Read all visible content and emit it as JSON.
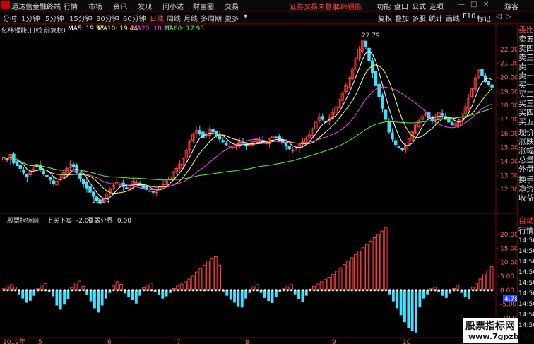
{
  "menubar": {
    "app_title": "通达信金融终端",
    "items": [
      "行情",
      "市场",
      "资讯",
      "发现",
      "问小达",
      "财富圈",
      "交易"
    ],
    "notice": "证券交易未登录",
    "notice2": "亿纬锂能",
    "right_items": [
      "功能",
      "盘口",
      "公式",
      "选项"
    ],
    "guest": "游客"
  },
  "toolbar": {
    "periods": [
      "分时",
      "1分钟",
      "5分钟",
      "15分钟",
      "30分钟",
      "60分钟",
      "日线",
      "周线",
      "月线",
      "多周期",
      "更多"
    ],
    "active_period": "日线",
    "right_items": [
      "复权",
      "叠加",
      "多股",
      "统计",
      "画线",
      "F10",
      "标记"
    ]
  },
  "main_chart": {
    "title": "亿纬锂能(日线 前复权)",
    "ma": [
      {
        "label": "MA5: 19.57",
        "color": "#ffffff"
      },
      {
        "label": "MA10: 19.44",
        "color": "#ffff40"
      },
      {
        "label": "MA20: 18.27",
        "color": "#ff40ff"
      },
      {
        "label": "MA60: 17.93",
        "color": "#40ff40"
      }
    ],
    "price_ticks": [
      "22.00",
      "21.00",
      "20.00",
      "19.00",
      "18.00",
      "17.00",
      "16.00",
      "15.00",
      "14.00",
      "13.00",
      "12.00"
    ],
    "high_label": "22.79",
    "low_label": "10.94"
  },
  "sub_chart": {
    "title": "股票指标网",
    "signal_label": "上买下卖: -2.00",
    "divider_label": "强弱分界: 0.00",
    "ticks": [
      "20.00",
      "15.00",
      "10.00",
      "5.00",
      "0.00",
      "-5.00",
      "-10.00"
    ],
    "current_value": "4.78"
  },
  "x_axis": {
    "labels": [
      "2019年",
      "5",
      "6",
      "7",
      "8",
      "9",
      "10"
    ]
  },
  "right_panel": {
    "quote_items": [
      "委比",
      "卖五",
      "卖四",
      "卖三",
      "卖二",
      "卖一",
      "买一",
      "买二",
      "买三",
      "买四",
      "买五",
      "现价",
      "涨跌",
      "涨幅",
      "总量",
      "外盘",
      "换手",
      "净资",
      "收益"
    ],
    "tabs": [
      "自动",
      "行情"
    ],
    "times": [
      "14:50",
      "14:50",
      "14:50",
      "14:50",
      "14:50",
      "14:50",
      "14:50",
      "14:50",
      "14:50",
      "14:50",
      "14:50"
    ]
  },
  "watermark": {
    "line1": "股票指标网",
    "line2": "www.7gpzb.com"
  },
  "colors": {
    "up": "#ff4040",
    "down": "#40e0ff",
    "ma5": "#ffffff",
    "ma10": "#ffff40",
    "ma20": "#ff40ff",
    "ma60": "#40ff40",
    "grid": "#7a0000"
  },
  "chart_data": {
    "type": "candlestick",
    "price_range": [
      10.6,
      23.3
    ],
    "candles_close": [
      14.3,
      14.1,
      14.5,
      13.9,
      13.7,
      13.5,
      13.2,
      12.9,
      13.3,
      13.6,
      13.8,
      13.4,
      13.1,
      12.9,
      12.7,
      12.4,
      12.6,
      12.9,
      13.2,
      13.5,
      13.8,
      13.6,
      13.2,
      12.8,
      12.4,
      12.1,
      11.8,
      11.5,
      11.2,
      11.0,
      11.3,
      11.7,
      12.0,
      12.3,
      12.5,
      12.4,
      12.2,
      12.1,
      12.3,
      12.6,
      12.5,
      12.3,
      12.1,
      12.0,
      11.9,
      11.8,
      12.0,
      12.2,
      12.4,
      12.6,
      12.9,
      13.2,
      13.5,
      13.8,
      14.2,
      14.8,
      15.4,
      15.9,
      16.2,
      16.0,
      15.7,
      15.9,
      16.3,
      16.1,
      15.8,
      15.6,
      15.4,
      15.2,
      15.1,
      15.0,
      15.2,
      15.4,
      15.3,
      15.1,
      15.2,
      15.4,
      15.6,
      15.5,
      15.3,
      15.4,
      15.6,
      15.8,
      15.7,
      15.5,
      15.3,
      15.1,
      14.9,
      14.8,
      15.0,
      15.2,
      15.4,
      15.6,
      15.9,
      16.3,
      16.8,
      17.2,
      17.0,
      16.8,
      17.1,
      17.5,
      17.9,
      18.4,
      18.9,
      19.4,
      19.9,
      20.6,
      21.3,
      22.0,
      22.6,
      22.2,
      21.2,
      20.3,
      19.4,
      18.6,
      17.8,
      17.0,
      16.1,
      15.6,
      15.2,
      15.0,
      14.8,
      15.1,
      15.6,
      16.1,
      16.6,
      16.9,
      17.2,
      17.4,
      17.1,
      16.9,
      17.2,
      17.5,
      17.3,
      17.0,
      16.8,
      16.6,
      16.7,
      16.9,
      17.4,
      17.9,
      18.5,
      19.2,
      19.9,
      20.5,
      20.1,
      19.7,
      19.5,
      19.3
    ],
    "indicator_values": [
      0.5,
      1.2,
      2.0,
      1.1,
      -1.5,
      -3.0,
      -4.5,
      -3.8,
      -2.0,
      0.5,
      1.8,
      2.4,
      -0.8,
      -2.2,
      -5.5,
      -7.0,
      -5.2,
      -3.1,
      0.9,
      2.6,
      3.2,
      1.4,
      -1.8,
      -4.0,
      -6.5,
      -8.0,
      -5.5,
      -3.0,
      -1.0,
      1.5,
      3.0,
      2.1,
      -1.2,
      -2.5,
      -3.6,
      -4.8,
      -2.0,
      0.8,
      1.9,
      2.5,
      -0.6,
      -1.8,
      -3.0,
      -2.2,
      -1.0,
      0.6,
      1.5,
      2.2,
      3.0,
      4.0,
      5.0,
      6.5,
      7.8,
      9.0,
      10.5,
      11.5,
      12.0,
      9.0,
      -0.5,
      -2.0,
      -3.5,
      -4.5,
      -5.8,
      -6.2,
      -3.0,
      -1.0,
      1.2,
      2.0,
      -1.0,
      -2.8,
      -3.9,
      -4.6,
      -2.5,
      -0.8,
      0.5,
      1.2,
      2.0,
      -1.5,
      -3.2,
      -4.2,
      -2.0,
      0.4,
      1.4,
      2.2,
      3.0,
      3.8,
      4.6,
      5.6,
      6.8,
      8.0,
      9.2,
      10.4,
      11.6,
      12.8,
      14.0,
      15.2,
      16.4,
      17.6,
      18.8,
      20.0,
      21.2,
      22.5,
      -1.5,
      -4.0,
      -6.5,
      -9.0,
      -11.5,
      -13.5,
      -14.5,
      -15.2,
      -6.0,
      -3.0,
      -1.5,
      0.5,
      1.0,
      -0.8,
      -2.0,
      -2.8,
      -1.2,
      0.6,
      1.8,
      -1.0,
      -2.4,
      -3.2,
      1.0,
      2.5,
      4.0,
      5.5,
      7.0,
      8.5
    ]
  }
}
